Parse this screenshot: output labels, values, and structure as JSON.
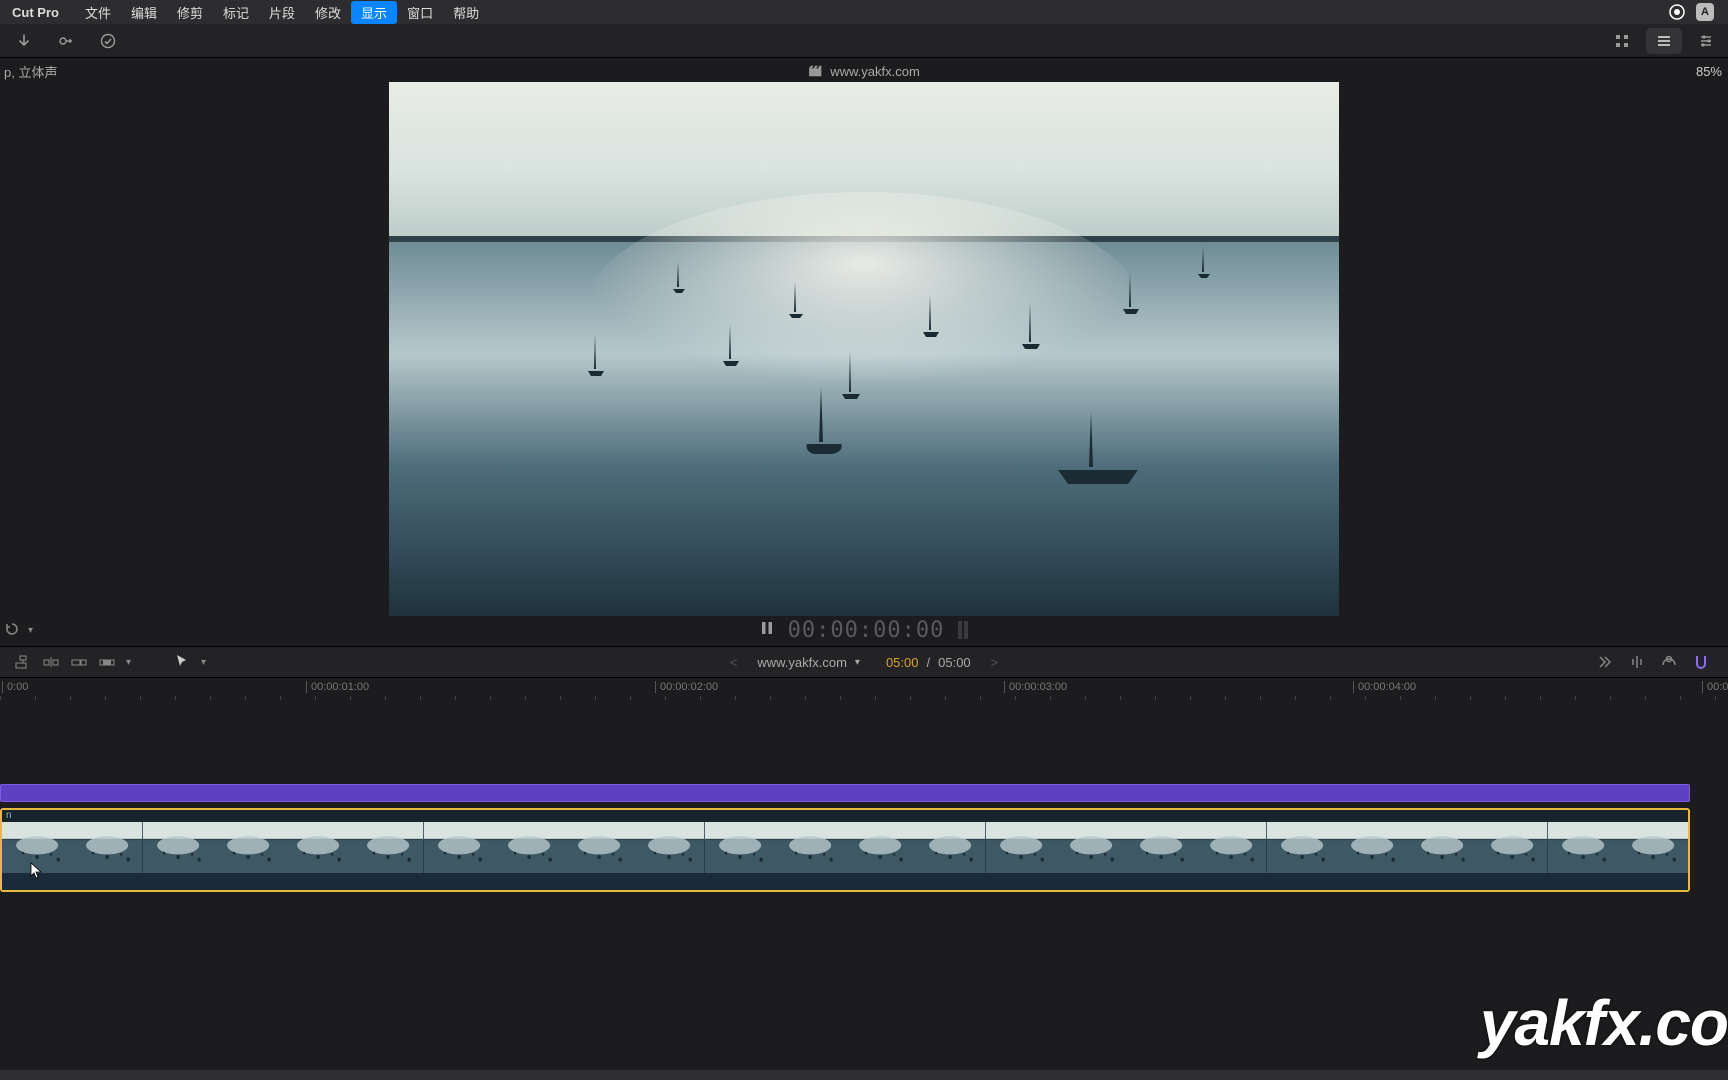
{
  "menubar": {
    "app_name": "Cut Pro",
    "items": [
      "文件",
      "编辑",
      "修剪",
      "标记",
      "片段",
      "修改",
      "显示",
      "窗口",
      "帮助"
    ],
    "active_index": 6,
    "right_badge": "A"
  },
  "toolbar": {
    "icons_left": [
      "arrow-down-icon",
      "key-icon",
      "check-circle-icon"
    ],
    "icons_right": [
      "grid-icon",
      "list-icon",
      "sliders-icon"
    ]
  },
  "viewer_header": {
    "meta_left": "p, 立体声",
    "clapper": "🎬",
    "project_name": "www.yakfx.com",
    "zoom": "85%"
  },
  "timecode": {
    "main": "00:00:00:00",
    "pause_icon": "||",
    "adjust_label": "⟲"
  },
  "lower": {
    "project_name": "www.yakfx.com",
    "elapsed": "05:00",
    "total": "05:00",
    "nav_prev": "<",
    "nav_next": ">",
    "dropdown_glyph": "▾"
  },
  "ruler": {
    "marks": [
      {
        "pos": 2,
        "label": "0:00"
      },
      {
        "pos": 306,
        "label": "00:00:01:00"
      },
      {
        "pos": 655,
        "label": "00:00:02:00"
      },
      {
        "pos": 1004,
        "label": "00:00:03:00"
      },
      {
        "pos": 1353,
        "label": "00:00:04:00"
      },
      {
        "pos": 1702,
        "label": "00:0"
      }
    ]
  },
  "clip": {
    "label": "n",
    "thumb_count": 24
  },
  "watermark": "yakfx.co",
  "colors": {
    "accent_purple": "#5e41c1",
    "accent_yellow": "#e8b93f"
  }
}
